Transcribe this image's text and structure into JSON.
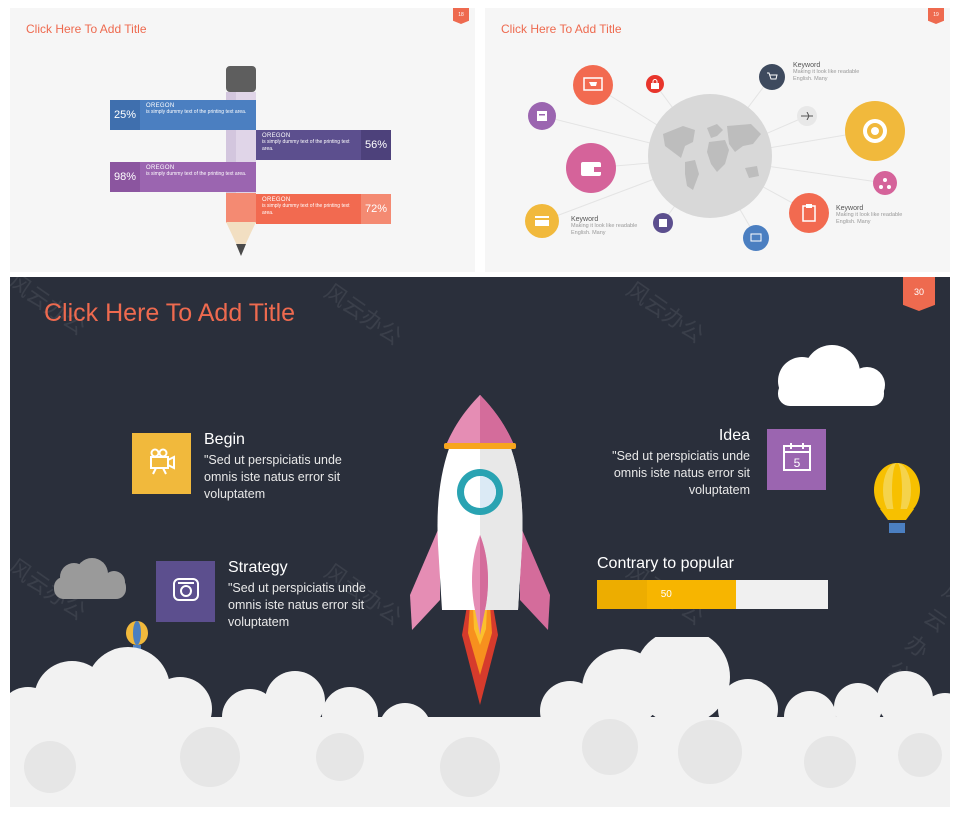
{
  "slide1": {
    "title": "Click Here To Add Title",
    "page_tag": "18",
    "bars": [
      {
        "pct": "25%",
        "heading": "OREGON",
        "desc": "is simply dummy text of the printing text area.",
        "color": "#4b7fc1"
      },
      {
        "pct": "56%",
        "heading": "OREGON",
        "desc": "is simply dummy text of the printing text area.",
        "color": "#5c4f8e"
      },
      {
        "pct": "98%",
        "heading": "OREGON",
        "desc": "is simply dummy text of the printing text area.",
        "color": "#9b65b0"
      },
      {
        "pct": "72%",
        "heading": "OREGON",
        "desc": "is simply dummy text of the printing text area.",
        "color": "#f26a50"
      }
    ]
  },
  "slide2": {
    "title": "Click Here To Add Title",
    "page_tag": "19",
    "keywords": [
      {
        "title": "Keyword",
        "desc": "Making it look like readable English. Many"
      },
      {
        "title": "Keyword",
        "desc": "Making it look like readable English. Many"
      },
      {
        "title": "Keyword",
        "desc": "Making it look like readable English. Many"
      }
    ],
    "icons": [
      "cart-icon",
      "lock-icon",
      "contact-card-icon",
      "wallet-icon",
      "credit-card-icon",
      "calculator-icon",
      "monitor-icon",
      "clipboard-icon",
      "target-icon",
      "network-icon",
      "shopping-cart-icon",
      "airplane-icon",
      "globe-map-icon"
    ]
  },
  "slide3": {
    "title": "Click Here To Add Title",
    "page_number": "30",
    "watermark": "风云办公",
    "begin": {
      "heading": "Begin",
      "body": "\"Sed ut perspiciatis unde omnis iste natus error sit voluptatem",
      "icon": "video-camera-icon",
      "color": "#f1b93c"
    },
    "strategy": {
      "heading": "Strategy",
      "body": "\"Sed ut perspiciatis unde omnis iste natus error sit voluptatem",
      "icon": "telephone-icon",
      "color": "#5c4f8e"
    },
    "idea": {
      "heading": "Idea",
      "body": "\"Sed ut perspiciatis unde omnis iste natus error sit voluptatem",
      "icon": "calendar-icon",
      "color": "#9b65b0"
    },
    "progress": {
      "label": "Contrary to popular",
      "value_text": "50",
      "value": 50,
      "fill_color": "#f7b500",
      "track_color": "#f0f0f0"
    },
    "accent_color": "#ee6a4f",
    "background_color": "#2a2f3b"
  }
}
